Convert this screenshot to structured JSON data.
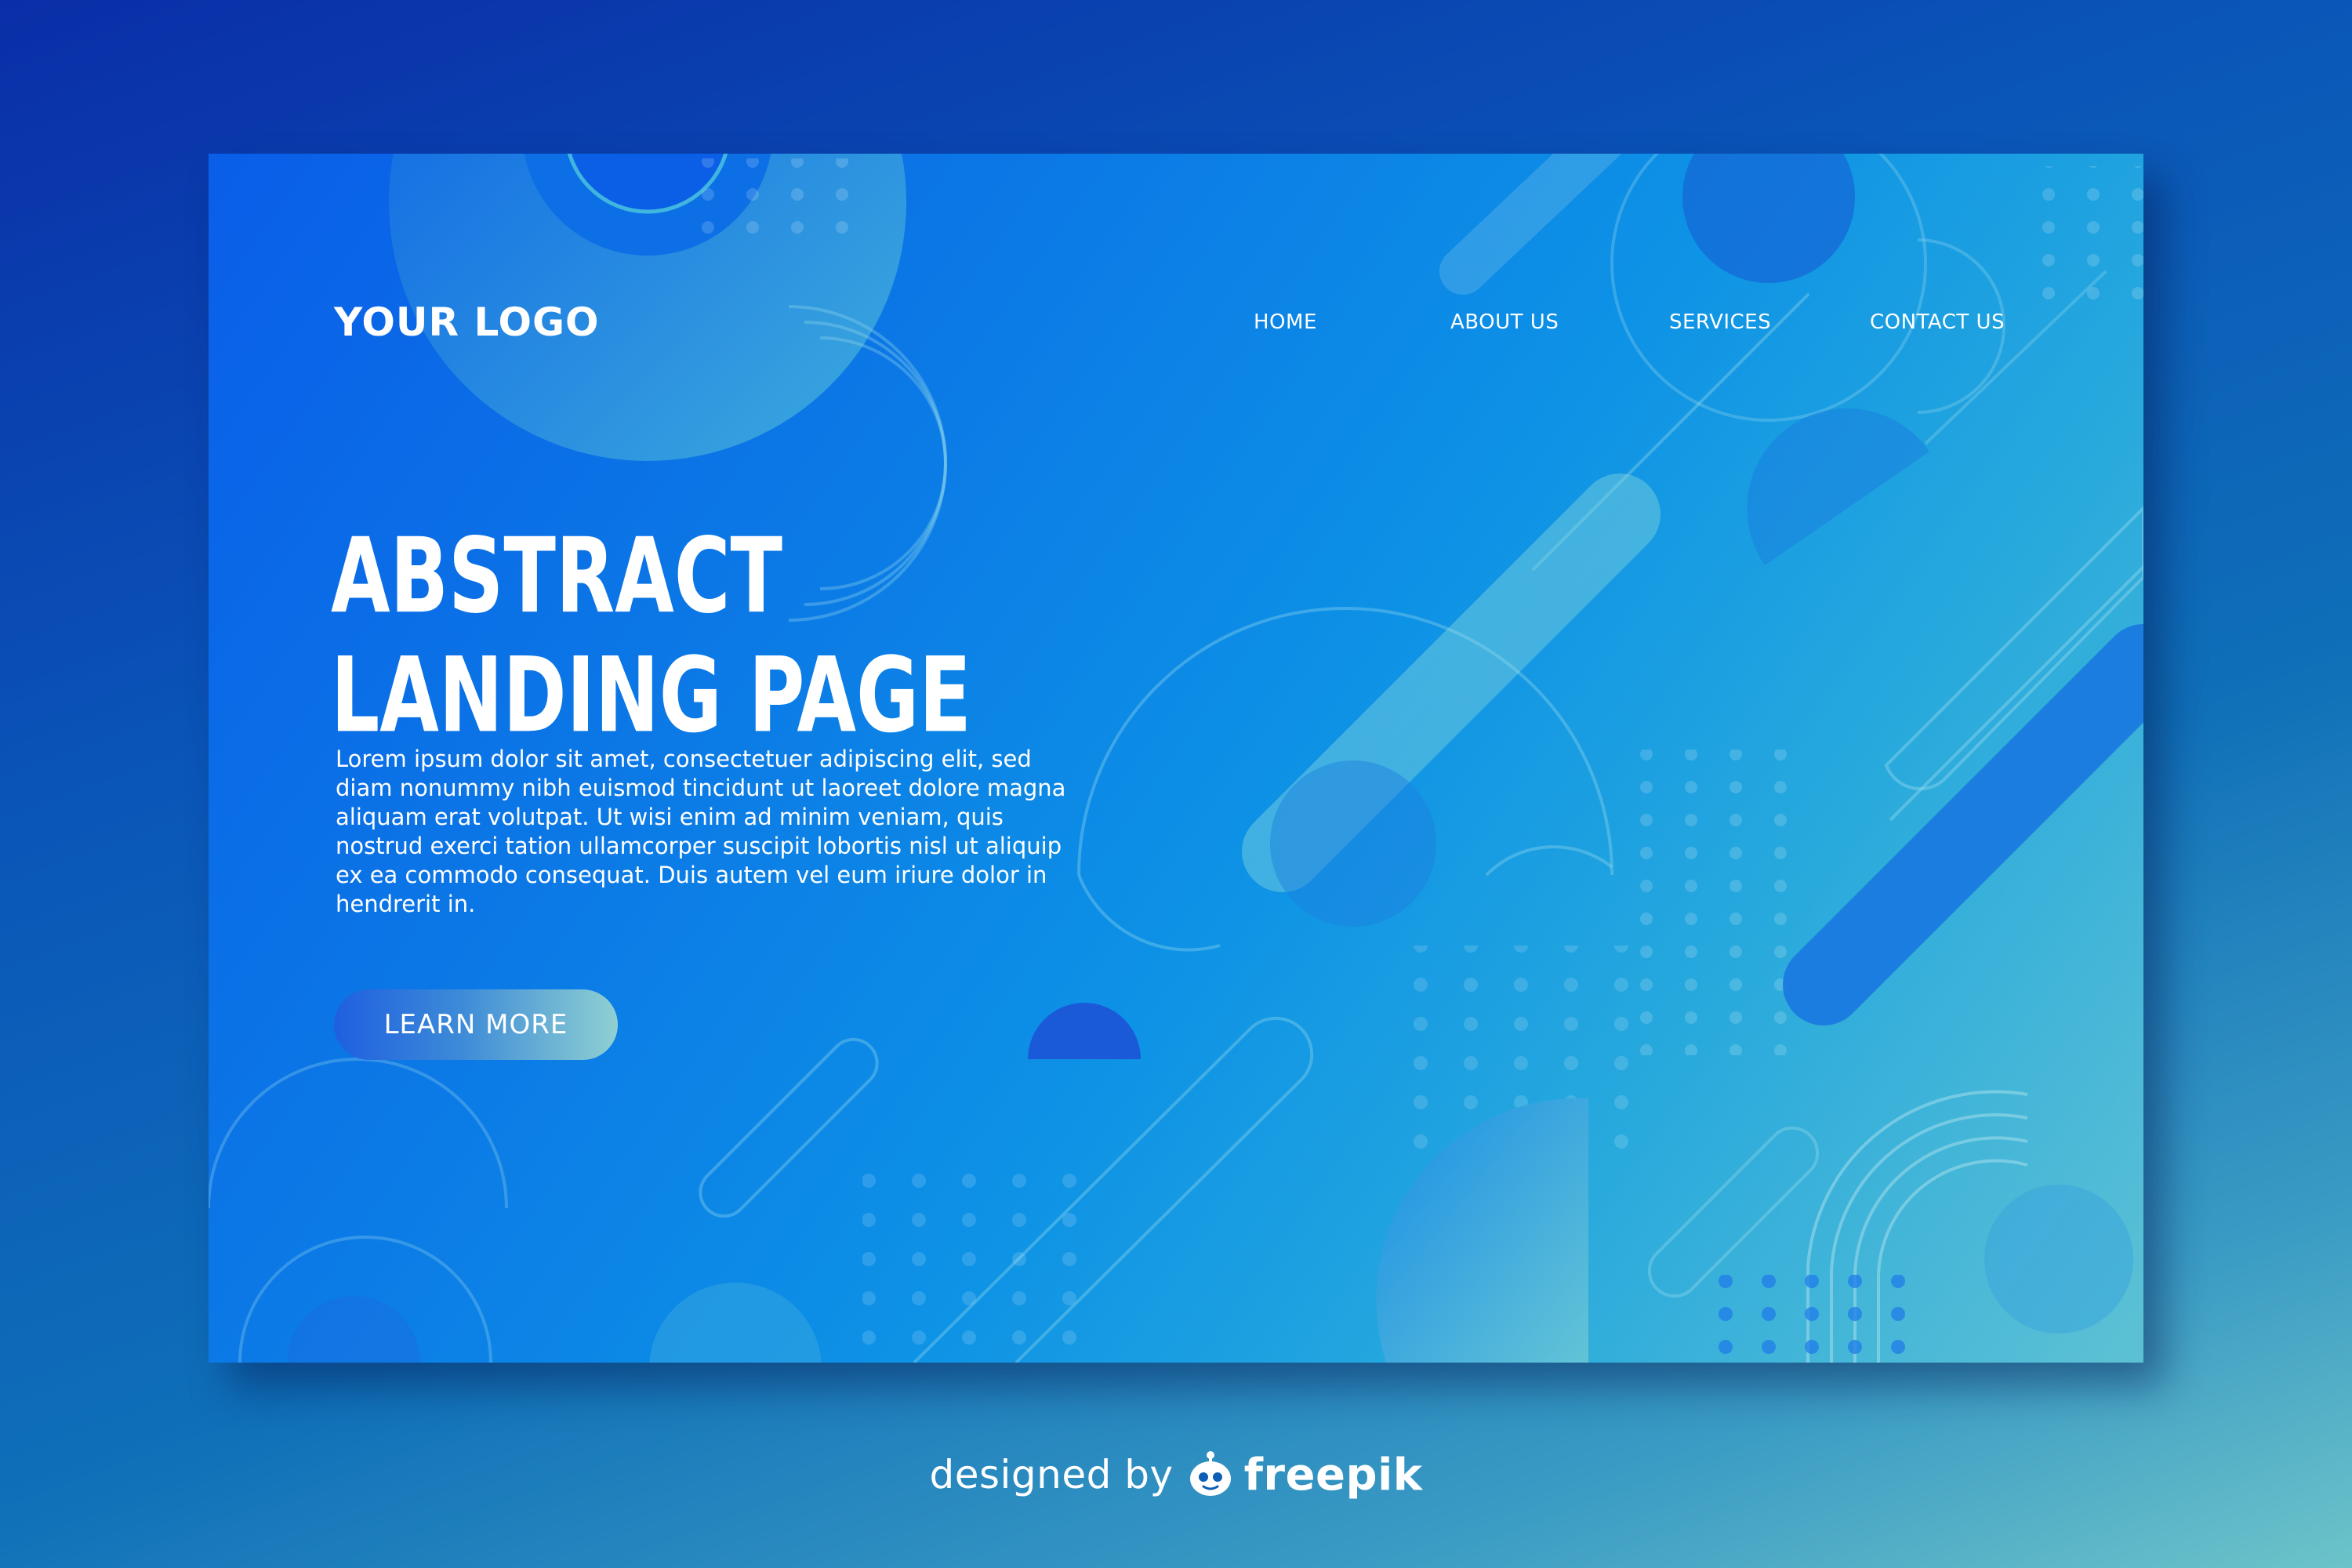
{
  "header": {
    "logo": "YOUR LOGO",
    "nav": [
      "HOME",
      "ABOUT US",
      "SERVICES",
      "CONTACT US"
    ]
  },
  "hero": {
    "title_line1": "ABSTRACT",
    "title_line2": "LANDING PAGE",
    "body": "Lorem ipsum dolor sit amet, consectetuer adipiscing elit, sed diam nonummy nibh euismod tincidunt ut laoreet dolore magna aliquam erat volutpat. Ut wisi enim ad minim veniam, quis nostrud exerci tation ullamcorper suscipit lobortis nisl ut aliquip ex ea commodo consequat. Duis autem vel eum iriure dolor in hendrerit in.",
    "cta_label": "LEARN MORE"
  },
  "footer": {
    "designed_by": "designed by",
    "brand": "freepik",
    "mascot_icon": "freepik-mascot-icon"
  },
  "colors": {
    "page_gradient_start": "#0a2ea8",
    "page_gradient_end": "#6cc3c9",
    "card_gradient_start": "#0a5ee8",
    "card_gradient_end": "#5dc1d4",
    "cta_gradient_start": "#1f5fe0",
    "cta_gradient_end": "#8fd0d2"
  }
}
